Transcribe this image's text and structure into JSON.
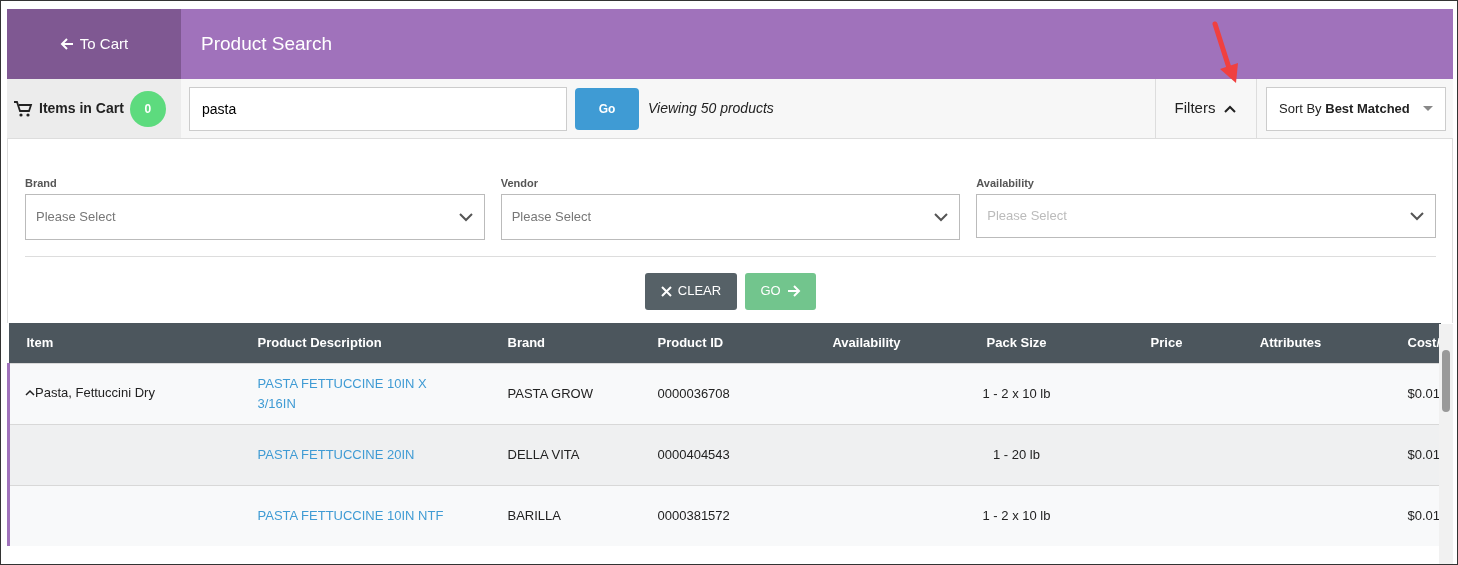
{
  "header": {
    "back_label": "To Cart",
    "title": "Product Search"
  },
  "toolbar": {
    "cart_label": "Items in Cart",
    "cart_count": "0",
    "search_value": "pasta",
    "go_label": "Go",
    "result_text": "Viewing 50 products",
    "filters_label": "Filters",
    "filters_expanded": true,
    "sort_prefix": "Sort By",
    "sort_value": "Best Matched"
  },
  "filters": [
    {
      "label": "Brand",
      "placeholder": "Please Select",
      "disabled": false
    },
    {
      "label": "Vendor",
      "placeholder": "Please Select",
      "disabled": false
    },
    {
      "label": "Availability",
      "placeholder": "Please Select",
      "disabled": true
    }
  ],
  "filter_buttons": {
    "clear": "CLEAR",
    "go": "GO",
    "go_disabled": true
  },
  "table": {
    "columns": [
      "Item",
      "Product Description",
      "Brand",
      "Product ID",
      "Availability",
      "Pack Size",
      "Price",
      "Attributes",
      "Cost/"
    ],
    "rows": [
      {
        "item": "Pasta, Fettuccini Dry",
        "expanded": true,
        "description": "PASTA FETTUCCINE 10IN X 3/16IN",
        "brand": "PASTA GROW",
        "product_id": "0000036708",
        "pack_size": "1 - 2 x 10 lb",
        "cost": "$0.01"
      },
      {
        "description": "PASTA FETTUCCINE 20IN",
        "brand": "DELLA VITA",
        "product_id": "0000404543",
        "pack_size": "1 - 20 lb",
        "cost": "$0.01"
      },
      {
        "description": "PASTA FETTUCCINE 10IN NTF",
        "brand": "BARILLA",
        "product_id": "0000381572",
        "pack_size": "1 - 2 x 10 lb",
        "cost": "$0.01"
      }
    ]
  }
}
